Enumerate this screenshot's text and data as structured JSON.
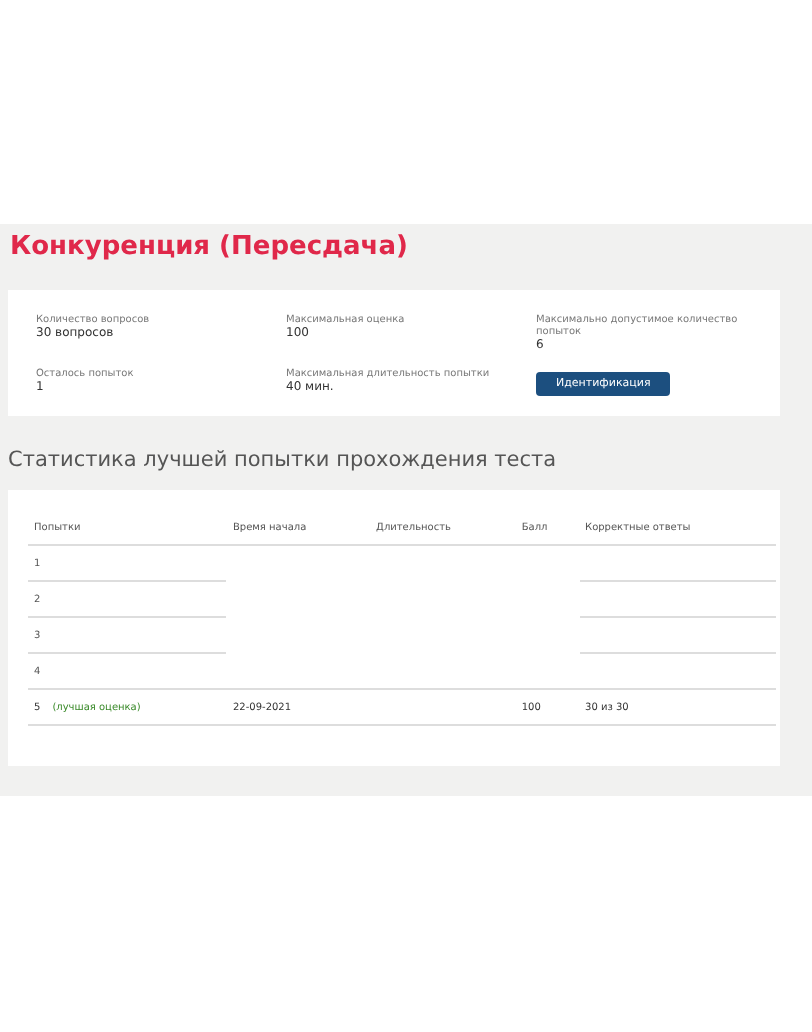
{
  "title": "Конкуренция (Пересдача)",
  "info": [
    {
      "label": "Количество вопросов",
      "value": "30 вопросов"
    },
    {
      "label": "Максимальная оценка",
      "value": "100"
    },
    {
      "label": "Максимально допустимое количество попыток",
      "value": "6"
    },
    {
      "label": "Осталось попыток",
      "value": "1"
    },
    {
      "label": "Максимальная длительность попытки",
      "value": "40 мин."
    }
  ],
  "identify_button": "Идентификация",
  "stats_title": "Статистика лучшей попытки прохождения теста",
  "table": {
    "columns": [
      "Попытки",
      "Время начала",
      "Длительность",
      "Балл",
      "Корректные ответы"
    ],
    "rows": [
      {
        "full_rule": false,
        "best": false,
        "cells": [
          "1",
          "",
          "",
          "",
          ""
        ]
      },
      {
        "full_rule": false,
        "best": false,
        "cells": [
          "2",
          "",
          "",
          "",
          ""
        ]
      },
      {
        "full_rule": false,
        "best": false,
        "cells": [
          "3",
          "",
          "",
          "",
          ""
        ]
      },
      {
        "full_rule": true,
        "best": false,
        "cells": [
          "4",
          "",
          "",
          "",
          ""
        ]
      },
      {
        "full_rule": true,
        "best": true,
        "note": "(лучшая оценка)",
        "cells": [
          "5",
          "22-09-2021",
          "",
          "100",
          "30 из 30"
        ]
      }
    ]
  }
}
